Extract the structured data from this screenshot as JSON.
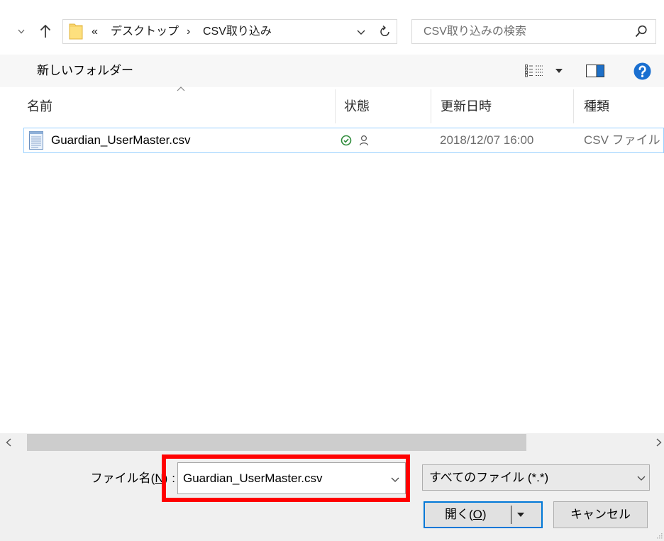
{
  "nav": {
    "recent_icon": "chevron-down-icon",
    "up_icon": "up-arrow-icon"
  },
  "address_bar": {
    "folder_icon": "folder-icon",
    "overflow": "«",
    "crumbs": [
      "デスクトップ",
      "CSV取り込み"
    ],
    "separator": "›",
    "dropdown_icon": "chevron-down-icon",
    "refresh_icon": "refresh-icon"
  },
  "search": {
    "placeholder": "CSV取り込みの検索",
    "icon": "search-icon"
  },
  "toolbar": {
    "new_folder": "新しいフォルダー",
    "view_icon": "details-view-icon",
    "view_menu_icon": "dropdown-arrow-icon",
    "preview_icon": "preview-pane-icon",
    "help_icon": "help-icon"
  },
  "columns": [
    {
      "label": "名前",
      "sort_icon": "sort-ascending-icon"
    },
    {
      "label": "状態"
    },
    {
      "label": "更新日時"
    },
    {
      "label": "種類"
    }
  ],
  "files": [
    {
      "name": "Guardian_UserMaster.csv",
      "icon": "csv-file-icon",
      "status_icons": [
        "check-circle-icon",
        "person-icon"
      ],
      "modified": "2018/12/07 16:00",
      "type": "CSV ファイル",
      "focused": true
    }
  ],
  "scrollbar": {
    "left_icon": "chevron-left-icon",
    "right_icon": "chevron-right-icon",
    "position": 0,
    "thumb_fraction": 0.8
  },
  "file_name": {
    "label": "ファイル名(",
    "accel": "N",
    "close": ")",
    "colon": ":",
    "value": "Guardian_UserMaster.csv"
  },
  "file_type_filter": {
    "value": "すべてのファイル (*.*)"
  },
  "buttons": {
    "open": {
      "label": "開く(",
      "accel": "O",
      "close": ")"
    },
    "cancel": "キャンセル"
  },
  "colors": {
    "accent": "#0078d7",
    "highlight": "#ff0000",
    "help": "#1a6fd0",
    "status_ok": "#2e8b3a",
    "folder": "#f8d46a",
    "row_focus": "#99d1ff",
    "secondary_text": "#6d6d6d",
    "pane": "#f0f0f0"
  }
}
